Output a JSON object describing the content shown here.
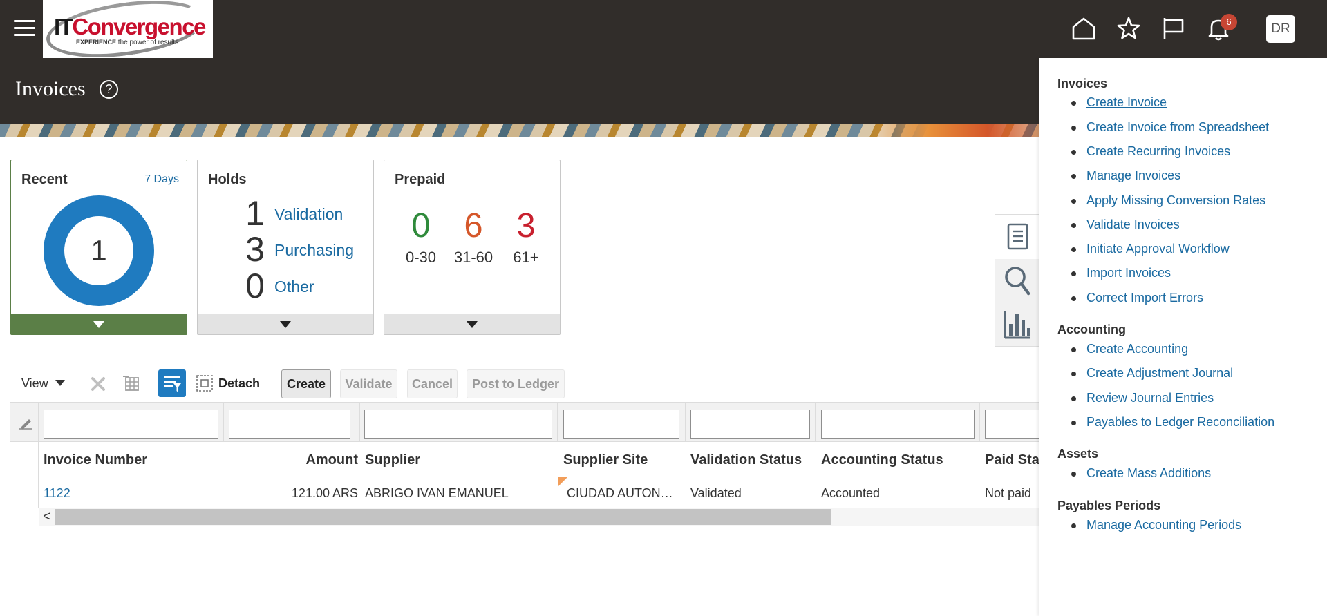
{
  "header": {
    "logo": {
      "brand_it": "IT",
      "brand_rest": "Convergence",
      "tag_bold": "EXPERIENCE",
      "tag_rest": " the power of results"
    },
    "icons": [
      "hamburger-menu-icon",
      "home-icon",
      "star-icon",
      "flag-icon",
      "bell-icon"
    ],
    "notification_count": "6",
    "user_initials": "DR",
    "badge_color": "#c74634"
  },
  "page": {
    "title": "Invoices",
    "help_symbol": "?"
  },
  "infolets": {
    "recent": {
      "title": "Recent",
      "range": "7 Days",
      "count": "1",
      "ring_color": "#1f7bc0",
      "footer_color": "#5b7f47"
    },
    "holds": {
      "title": "Holds",
      "rows": [
        {
          "count": "1",
          "label": "Validation"
        },
        {
          "count": "3",
          "label": "Purchasing"
        },
        {
          "count": "0",
          "label": "Other"
        }
      ]
    },
    "prepaid": {
      "title": "Prepaid",
      "buckets": [
        {
          "count": "0",
          "range": "0-30",
          "color": "#2f8a3b"
        },
        {
          "count": "6",
          "range": "31-60",
          "color": "#d5572a"
        },
        {
          "count": "3",
          "range": "61+",
          "color": "#c8202e"
        }
      ]
    }
  },
  "toolbar": {
    "view_label": "View",
    "detach_label": "Detach",
    "create_label": "Create",
    "validate_label": "Validate",
    "cancel_label": "Cancel",
    "post_label": "Post to Ledger"
  },
  "table": {
    "columns": [
      "Invoice Number",
      "Amount",
      "Supplier",
      "Supplier Site",
      "Validation Status",
      "Accounting Status",
      "Paid Sta"
    ],
    "rows": [
      {
        "invoice_number": "1122",
        "amount": "121.00 ARS",
        "supplier": "ABRIGO IVAN EMANUEL",
        "supplier_site": "CIUDAD AUTON…",
        "validation_status": "Validated",
        "accounting_status": "Accounted",
        "paid_status": "Not paid"
      }
    ],
    "scroll_left_symbol": "<"
  },
  "tasks": {
    "groups": [
      {
        "title": "Invoices",
        "items": [
          "Create Invoice",
          "Create Invoice from Spreadsheet",
          "Create Recurring Invoices",
          "Manage Invoices",
          "Apply Missing Conversion Rates",
          "Validate Invoices",
          "Initiate Approval Workflow",
          "Import Invoices",
          "Correct Import Errors"
        ]
      },
      {
        "title": "Accounting",
        "items": [
          "Create Accounting",
          "Create Adjustment Journal",
          "Review Journal Entries",
          "Payables to Ledger Reconciliation"
        ]
      },
      {
        "title": "Assets",
        "items": [
          "Create Mass Additions"
        ]
      },
      {
        "title": "Payables Periods",
        "items": [
          "Manage Accounting Periods"
        ]
      }
    ]
  },
  "side_tabs": [
    "tasks-icon",
    "search-icon",
    "reports-icon"
  ]
}
